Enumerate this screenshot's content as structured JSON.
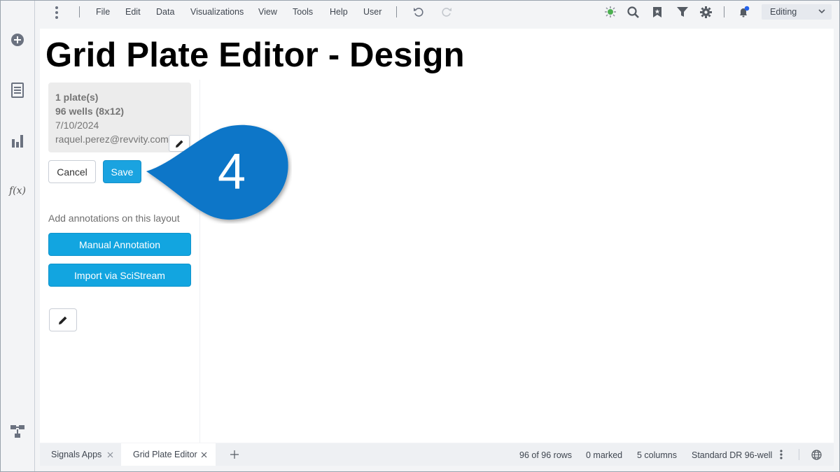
{
  "menubar": {
    "items": [
      "File",
      "Edit",
      "Data",
      "Visualizations",
      "View",
      "Tools",
      "Help",
      "User"
    ],
    "mode_select": "Editing"
  },
  "icons": {
    "rail": [
      "add-circle-icon",
      "document-list-icon",
      "bar-chart-icon",
      "function-fx-icon",
      "workflow-icon"
    ],
    "toolbar": [
      "undo-icon",
      "redo-icon",
      "recommendations-icon",
      "search-icon",
      "bookmark-icon",
      "filter-icon",
      "settings-icon",
      "notifications-icon"
    ]
  },
  "rail": {
    "fx_label": "f(x)"
  },
  "page": {
    "title": "Grid Plate Editor - Design"
  },
  "card": {
    "plates": "1 plate(s)",
    "wells": "96 wells (8x12)",
    "date": "7/10/2024",
    "email": "raquel.perez@revvity.com#"
  },
  "buttons": {
    "cancel": "Cancel",
    "save": "Save",
    "manual_annotation": "Manual Annotation",
    "import_scistream": "Import via SciStream"
  },
  "annotations_label": "Add annotations on this layout",
  "callout": {
    "number": "4"
  },
  "statusbar": {
    "tabs": [
      "Signals Apps",
      "Grid Plate Editor"
    ],
    "rows": "96 of 96 rows",
    "marked": "0 marked",
    "columns": "5 columns",
    "layout": "Standard DR 96-well"
  },
  "colors": {
    "accent": "#1aa3e0",
    "callout": "#0b76c8",
    "notification_dot": "#2563eb",
    "recommend_icon": "#4caf50"
  }
}
